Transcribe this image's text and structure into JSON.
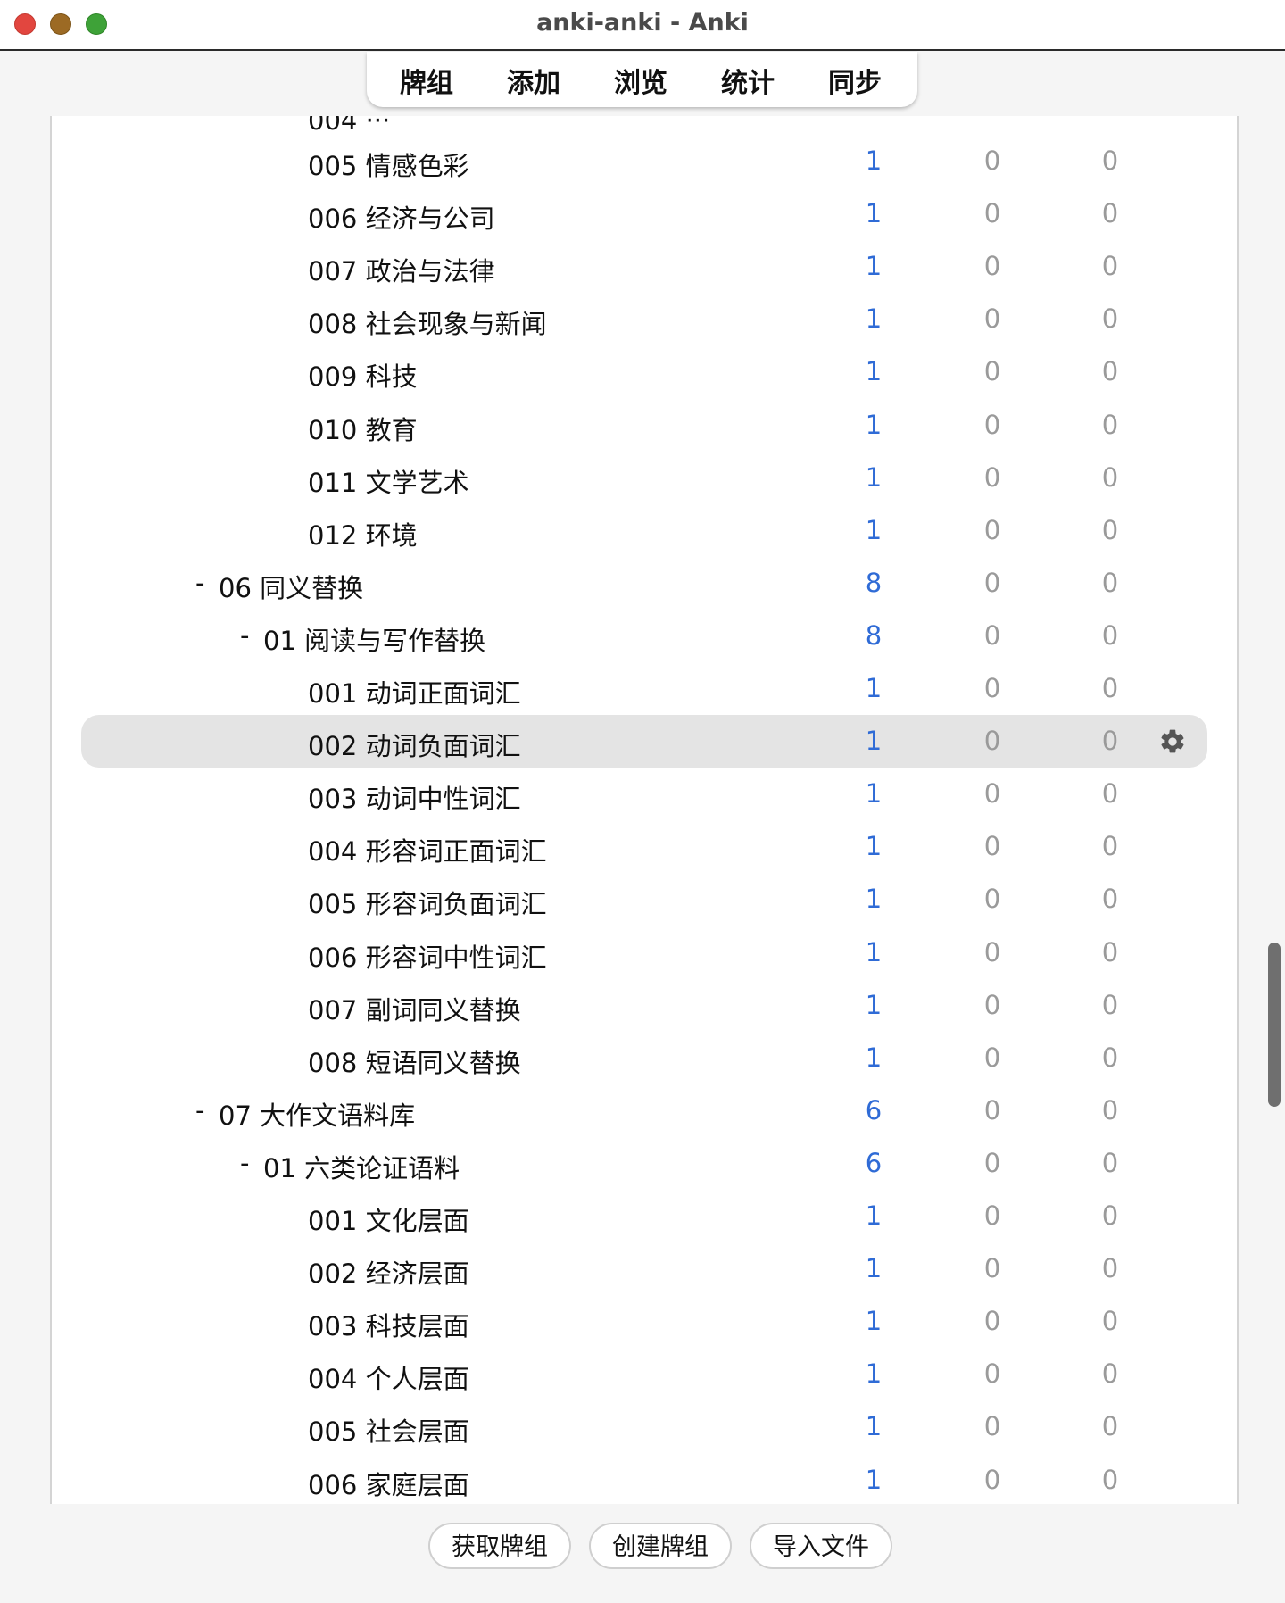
{
  "window": {
    "title": "anki-anki - Anki"
  },
  "toolbar": {
    "decks": "牌组",
    "add": "添加",
    "browse": "浏览",
    "stats": "统计",
    "sync": "同步"
  },
  "deck_rows": [
    {
      "name": "005 情感色彩",
      "new": "1",
      "learn": "0",
      "review": "0",
      "level": 2,
      "collapse": ""
    },
    {
      "name": "006 经济与公司",
      "new": "1",
      "learn": "0",
      "review": "0",
      "level": 2,
      "collapse": ""
    },
    {
      "name": "007 政治与法律",
      "new": "1",
      "learn": "0",
      "review": "0",
      "level": 2,
      "collapse": ""
    },
    {
      "name": "008 社会现象与新闻",
      "new": "1",
      "learn": "0",
      "review": "0",
      "level": 2,
      "collapse": ""
    },
    {
      "name": "009 科技",
      "new": "1",
      "learn": "0",
      "review": "0",
      "level": 2,
      "collapse": ""
    },
    {
      "name": "010 教育",
      "new": "1",
      "learn": "0",
      "review": "0",
      "level": 2,
      "collapse": ""
    },
    {
      "name": "011 文学艺术",
      "new": "1",
      "learn": "0",
      "review": "0",
      "level": 2,
      "collapse": ""
    },
    {
      "name": "012 环境",
      "new": "1",
      "learn": "0",
      "review": "0",
      "level": 2,
      "collapse": ""
    },
    {
      "name": "06 同义替换",
      "new": "8",
      "learn": "0",
      "review": "0",
      "level": 0,
      "collapse": "-"
    },
    {
      "name": "01 阅读与写作替换",
      "new": "8",
      "learn": "0",
      "review": "0",
      "level": 1,
      "collapse": "-"
    },
    {
      "name": "001 动词正面词汇",
      "new": "1",
      "learn": "0",
      "review": "0",
      "level": 2,
      "collapse": ""
    },
    {
      "name": "002 动词负面词汇",
      "new": "1",
      "learn": "0",
      "review": "0",
      "level": 2,
      "collapse": "",
      "current": true
    },
    {
      "name": "003 动词中性词汇",
      "new": "1",
      "learn": "0",
      "review": "0",
      "level": 2,
      "collapse": ""
    },
    {
      "name": "004 形容词正面词汇",
      "new": "1",
      "learn": "0",
      "review": "0",
      "level": 2,
      "collapse": ""
    },
    {
      "name": "005 形容词负面词汇",
      "new": "1",
      "learn": "0",
      "review": "0",
      "level": 2,
      "collapse": ""
    },
    {
      "name": "006 形容词中性词汇",
      "new": "1",
      "learn": "0",
      "review": "0",
      "level": 2,
      "collapse": ""
    },
    {
      "name": "007 副词同义替换",
      "new": "1",
      "learn": "0",
      "review": "0",
      "level": 2,
      "collapse": ""
    },
    {
      "name": "008 短语同义替换",
      "new": "1",
      "learn": "0",
      "review": "0",
      "level": 2,
      "collapse": ""
    },
    {
      "name": "07 大作文语料库",
      "new": "6",
      "learn": "0",
      "review": "0",
      "level": 0,
      "collapse": "-"
    },
    {
      "name": "01 六类论证语料",
      "new": "6",
      "learn": "0",
      "review": "0",
      "level": 1,
      "collapse": "-"
    },
    {
      "name": "001 文化层面",
      "new": "1",
      "learn": "0",
      "review": "0",
      "level": 2,
      "collapse": ""
    },
    {
      "name": "002 经济层面",
      "new": "1",
      "learn": "0",
      "review": "0",
      "level": 2,
      "collapse": ""
    },
    {
      "name": "003 科技层面",
      "new": "1",
      "learn": "0",
      "review": "0",
      "level": 2,
      "collapse": ""
    },
    {
      "name": "004 个人层面",
      "new": "1",
      "learn": "0",
      "review": "0",
      "level": 2,
      "collapse": ""
    },
    {
      "name": "005 社会层面",
      "new": "1",
      "learn": "0",
      "review": "0",
      "level": 2,
      "collapse": ""
    },
    {
      "name": "006 家庭层面",
      "new": "1",
      "learn": "0",
      "review": "0",
      "level": 2,
      "collapse": ""
    }
  ],
  "footer": {
    "get_shared": "获取牌组",
    "create_deck": "创建牌组",
    "import_file": "导入文件"
  },
  "colors": {
    "new_count": "#2f6bd6",
    "zero_count": "#9a9a9a",
    "current_row": "#e4e4e4"
  },
  "icons": {
    "options": "gear-icon"
  }
}
